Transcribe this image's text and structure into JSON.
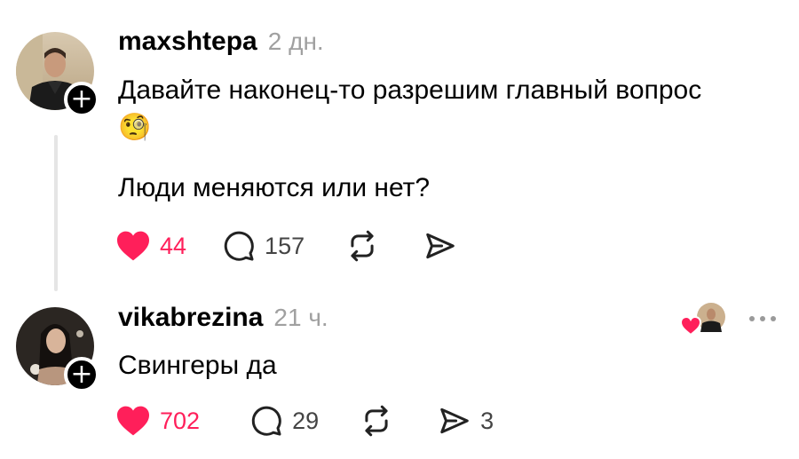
{
  "posts": [
    {
      "username": "maxshtepa",
      "time": "2 дн.",
      "text_line1": "Давайте наконец-то разрешим главный вопрос",
      "emoji": "🧐",
      "text_line2": "Люди меняются или нет?",
      "likes": "44",
      "replies": "157",
      "avatar_icon": "user-avatar",
      "follow_icon": "plus-icon"
    },
    {
      "username": "vikabrezina",
      "time": "21 ч.",
      "text_line1": "Свингеры да",
      "likes": "702",
      "replies": "29",
      "shares": "3",
      "avatar_icon": "user-avatar",
      "follow_icon": "plus-icon"
    }
  ],
  "colors": {
    "like": "#ff1f5a",
    "text": "#000000",
    "muted": "#a0a0a0",
    "thread_line": "#e5e5e5"
  }
}
